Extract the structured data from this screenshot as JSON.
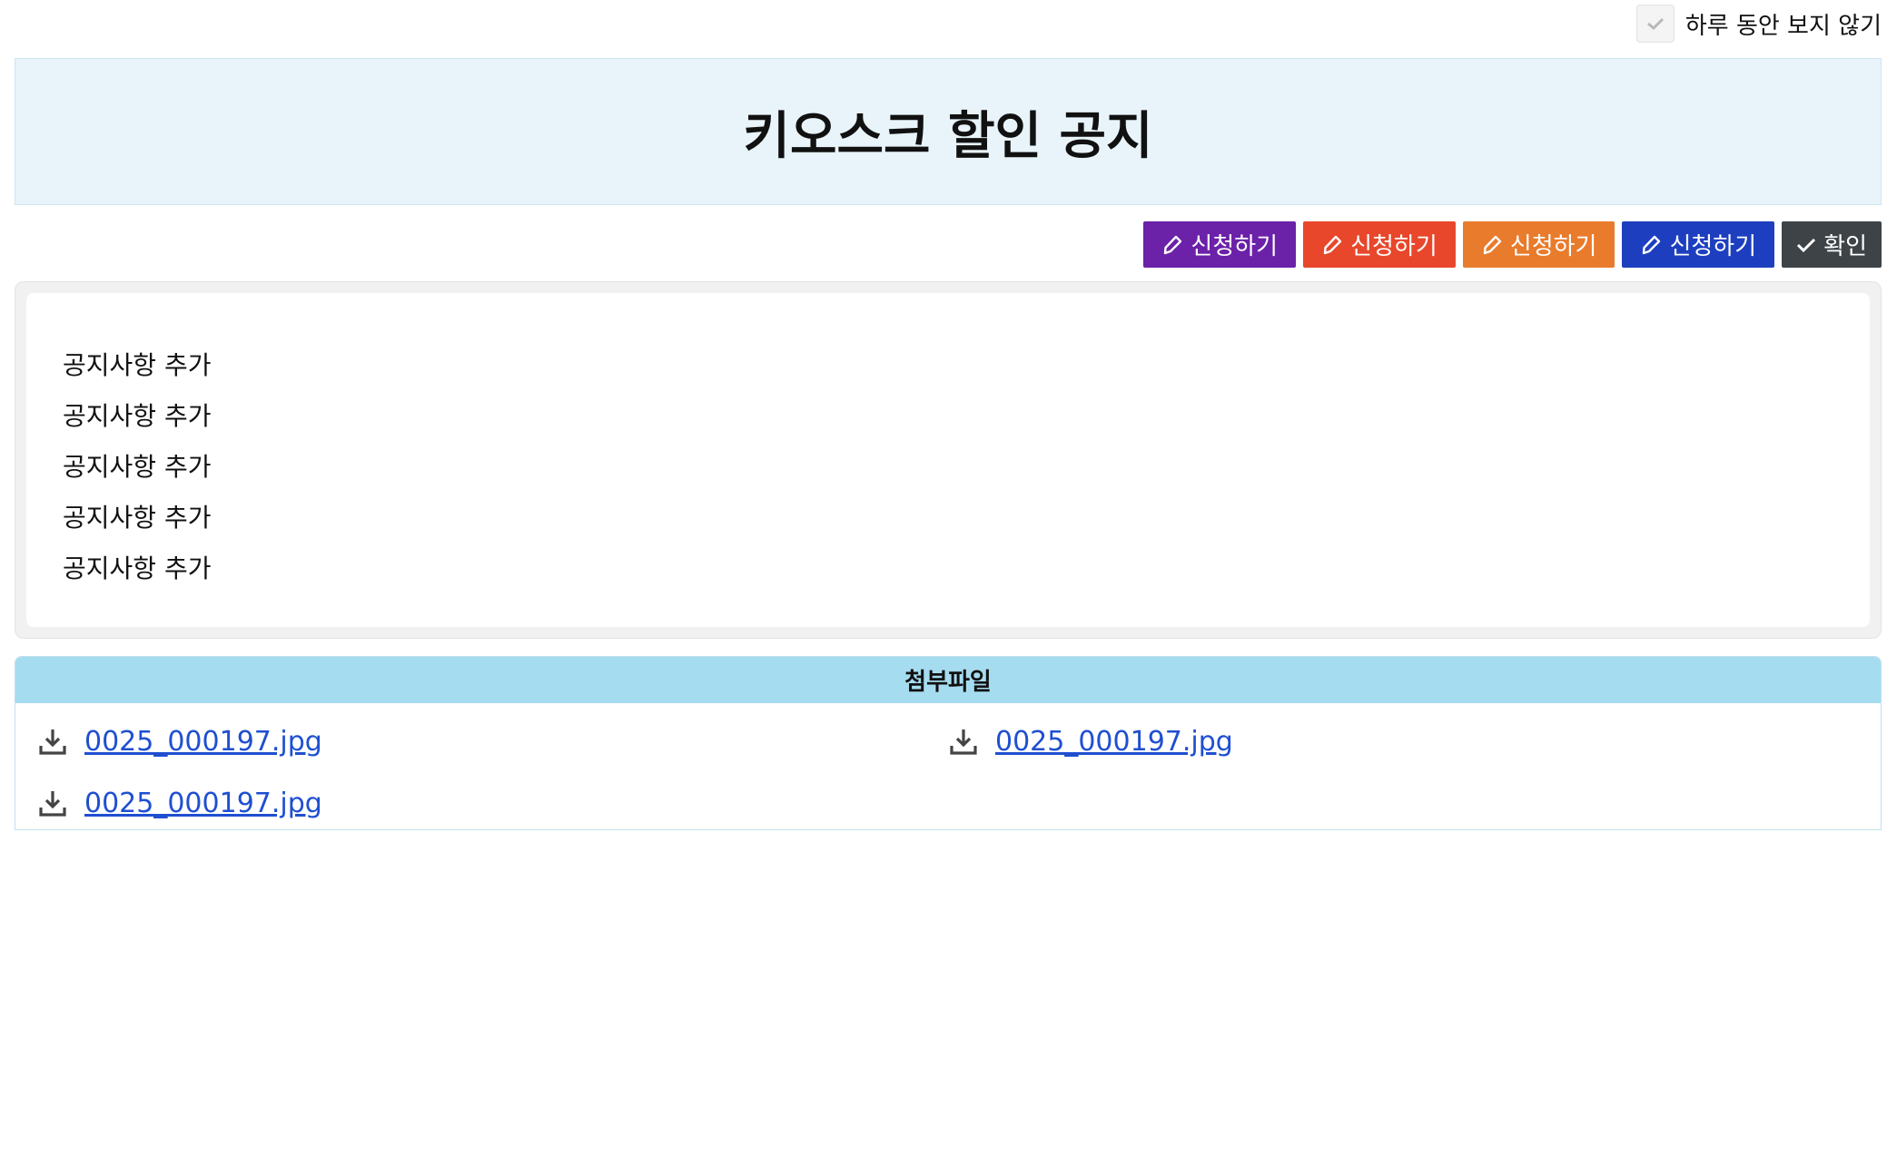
{
  "topbar": {
    "hide_today_label": "하루 동안 보지 않기",
    "hide_today_checked": false
  },
  "header": {
    "title": "키오스크 할인 공지",
    "background": "#e8f4fa"
  },
  "actions": [
    {
      "label": "신청하기",
      "icon": "pencil-icon",
      "color": "#6b21a8"
    },
    {
      "label": "신청하기",
      "icon": "pencil-icon",
      "color": "#e8472b"
    },
    {
      "label": "신청하기",
      "icon": "pencil-icon",
      "color": "#e97b2c"
    },
    {
      "label": "신청하기",
      "icon": "pencil-icon",
      "color": "#1d3fbf"
    },
    {
      "label": "확인",
      "icon": "check-icon",
      "color": "#3d4347"
    }
  ],
  "notice": {
    "lines": [
      "공지사항 추가",
      "공지사항 추가",
      "공지사항 추가",
      "공지사항 추가",
      "공지사항 추가"
    ]
  },
  "attachments": {
    "title": "첨부파일",
    "header_color": "#a6dcf0",
    "link_color": "#1f4fd1",
    "files": [
      {
        "name": "0025_000197.jpg",
        "icon": "download-icon"
      },
      {
        "name": "0025_000197.jpg",
        "icon": "download-icon"
      },
      {
        "name": "0025_000197.jpg",
        "icon": "download-icon"
      }
    ]
  }
}
